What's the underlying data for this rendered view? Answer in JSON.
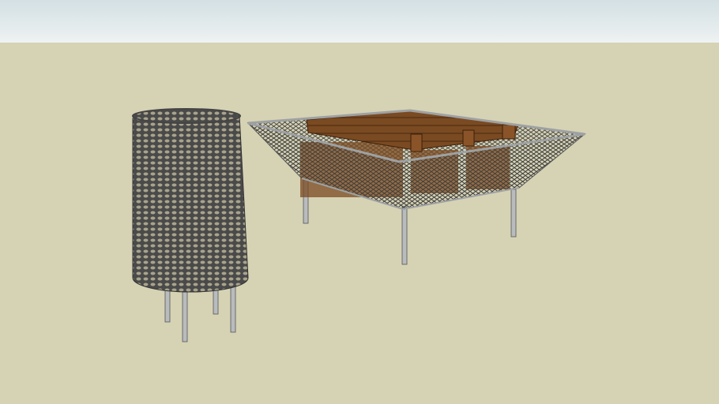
{
  "scene": {
    "colors": {
      "sky_top": "#d3e0e4",
      "sky_horizon": "#eef2f2",
      "ground": "#d6d2b4",
      "mesh": "#3a3a3a",
      "metal": "#b9bcbd",
      "wood": "#7a4a22",
      "wood_dark": "#5a3315"
    },
    "objects": [
      "cylindrical-mesh-basket",
      "mesh-tray-with-pallet"
    ]
  }
}
